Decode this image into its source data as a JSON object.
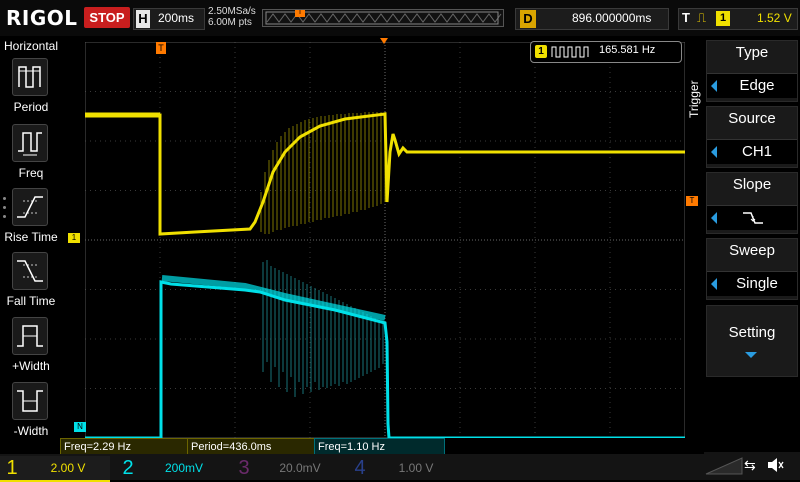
{
  "brand": "RIGOL",
  "run_state": "STOP",
  "horizontal": {
    "key": "H",
    "timebase": "200ms",
    "sample_rate": "2.50MSa/s",
    "points": "6.00M pts"
  },
  "delay": {
    "key": "D",
    "value": "896.000000ms"
  },
  "trigger_status": {
    "key": "T",
    "channel": "1",
    "level": "1.52 V"
  },
  "left_panel": {
    "title": "Horizontal",
    "items": [
      {
        "label": "Period"
      },
      {
        "label": "Freq"
      },
      {
        "label": "Rise Time"
      },
      {
        "label": "Fall Time"
      },
      {
        "label": "+Width"
      },
      {
        "label": "-Width"
      }
    ]
  },
  "freq_counter": {
    "channel": "1",
    "value": "165.581 Hz"
  },
  "right_panel": {
    "vertical_title": "Trigger",
    "type": {
      "title": "Type",
      "value": "Edge"
    },
    "source": {
      "title": "Source",
      "value": "CH1"
    },
    "slope": {
      "title": "Slope"
    },
    "sweep": {
      "title": "Sweep",
      "value": "Single"
    },
    "setting": {
      "title": "Setting"
    }
  },
  "measurements": [
    "Freq=2.29 Hz",
    "Period=436.0ms",
    "Freq=1.10 Hz"
  ],
  "channels": [
    {
      "num": "1",
      "scale": "2.00 V",
      "color": "#f0e000"
    },
    {
      "num": "2",
      "scale": "200mV",
      "color": "#00e0e8"
    },
    {
      "num": "3",
      "scale": "20.0mV",
      "color": "#d040d0"
    },
    {
      "num": "4",
      "scale": "1.00 V",
      "color": "#2a6cff"
    }
  ],
  "marker_labels": {
    "trigger": "T",
    "ch1": "1",
    "ch2": "N"
  }
}
